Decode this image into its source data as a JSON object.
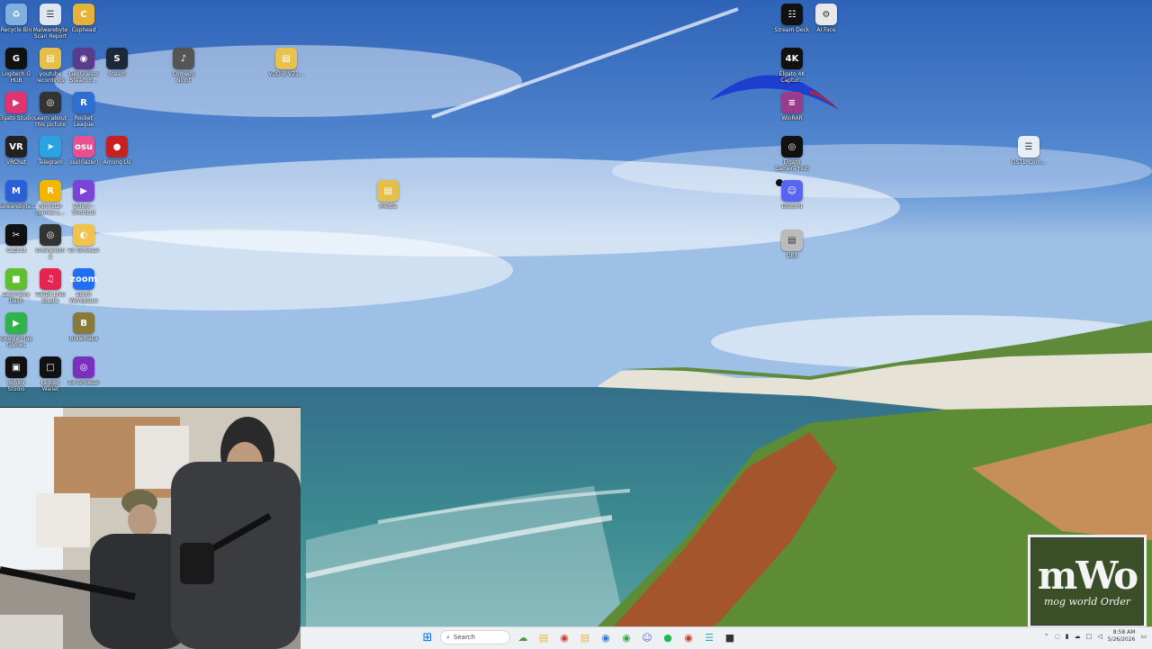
{
  "desktop_icons": [
    {
      "id": "recycle",
      "label": "Recycle Bin",
      "glyph": "♻",
      "color": "#7fb0e0",
      "icon": "recycle-bin-icon"
    },
    {
      "id": "malwarebytes-scan",
      "label": "Malwarebyte\nScan Report",
      "glyph": "☰",
      "color": "#dfe6ef",
      "icon": "document-icon"
    },
    {
      "id": "cuphead",
      "label": "Cuphead",
      "glyph": "C",
      "color": "#e6b33a",
      "icon": "cuphead-icon"
    },
    {
      "id": "logitech",
      "label": "Logitech G\nHUB",
      "glyph": "G",
      "color": "#111",
      "icon": "logitech-g-icon"
    },
    {
      "id": "youtube-rec",
      "label": "youtube\nrecordings",
      "glyph": "▤",
      "color": "#e4c04a",
      "icon": "folder-icon"
    },
    {
      "id": "geoguessr",
      "label": "GeoGuessr\nSteam E...",
      "glyph": "◉",
      "color": "#5a3b8c",
      "icon": "geoguessr-icon"
    },
    {
      "id": "steam",
      "label": "Steam",
      "glyph": "S",
      "color": "#1b2838",
      "icon": "steam-icon"
    },
    {
      "id": "comedy-night",
      "label": "Comedy\nNight",
      "glyph": "♪",
      "color": "#555",
      "icon": "microphone-icon"
    },
    {
      "id": "vdo-folder",
      "label": "VDO-B VZ1...",
      "glyph": "▤",
      "color": "#e8c24c",
      "icon": "folder-icon"
    },
    {
      "id": "elgato-studio",
      "label": "Elgato Studio",
      "glyph": "▶",
      "color": "#e0336f",
      "icon": "elgato-studio-icon"
    },
    {
      "id": "learn-pc",
      "label": "Learn about\nthis picture",
      "glyph": "◎",
      "color": "#333",
      "icon": "camera-icon"
    },
    {
      "id": "rocket-league",
      "label": "Rocket\nLeague",
      "glyph": "R",
      "color": "#2f6fd1",
      "icon": "rocket-league-icon"
    },
    {
      "id": "vrchat",
      "label": "VRChat",
      "glyph": "VR",
      "color": "#222",
      "icon": "vrchat-icon"
    },
    {
      "id": "telegram",
      "label": "Telegram",
      "glyph": "➤",
      "color": "#2aa3e0",
      "icon": "telegram-icon"
    },
    {
      "id": "osu",
      "label": "osu!(lazer)",
      "glyph": "osu",
      "color": "#e8508f",
      "icon": "osu-icon"
    },
    {
      "id": "among-us",
      "label": "Among Us",
      "glyph": "●",
      "color": "#c8201f",
      "icon": "among-us-icon"
    },
    {
      "id": "malwarebytes",
      "label": "Malwarebyte...",
      "glyph": "M",
      "color": "#2b5fd9",
      "icon": "malwarebytes-icon"
    },
    {
      "id": "rockstar",
      "label": "Rockstar\nGames L...",
      "glyph": "R",
      "color": "#f3b600",
      "icon": "rockstar-icon"
    },
    {
      "id": "videos-shortcut",
      "label": "Videos -\nShortcut",
      "glyph": "▶",
      "color": "#7a45d6",
      "icon": "videos-icon"
    },
    {
      "id": "imedia",
      "label": "iMedia",
      "glyph": "▤",
      "color": "#e3c04c",
      "icon": "folder-icon"
    },
    {
      "id": "capcut",
      "label": "CapCut",
      "glyph": "✂",
      "color": "#111",
      "icon": "capcut-icon"
    },
    {
      "id": "overwatch",
      "label": "Overwatch\n2",
      "glyph": "◎",
      "color": "#333",
      "icon": "overwatch-icon"
    },
    {
      "id": "tor-browser",
      "label": "Tor Browser",
      "glyph": "◐",
      "color": "#f2c24a",
      "icon": "tor-browser-icon"
    },
    {
      "id": "geometry-dash",
      "label": "Geometry\nDash",
      "glyph": "■",
      "color": "#5fbf2c",
      "icon": "geometry-dash-icon"
    },
    {
      "id": "tiktok-live",
      "label": "TikTok LIVE\nStudio",
      "glyph": "♫",
      "color": "#e5244f",
      "icon": "tiktok-icon"
    },
    {
      "id": "zoom",
      "label": "Zoom\nWorkplace",
      "glyph": "zoom",
      "color": "#1f6ef5",
      "icon": "zoom-icon"
    },
    {
      "id": "google-play",
      "label": "Google Play\nGames",
      "glyph": "▶",
      "color": "#2fb34a",
      "icon": "google-play-icon"
    },
    {
      "id": "brawlhalla",
      "label": "Brawlhalla",
      "glyph": "B",
      "color": "#8a7a3a",
      "icon": "brawlhalla-icon"
    },
    {
      "id": "roblox",
      "label": "Roblox\nStudio",
      "glyph": "▣",
      "color": "#111",
      "icon": "roblox-icon"
    },
    {
      "id": "ledger",
      "label": "Ledger\nWallet",
      "glyph": "□",
      "color": "#111",
      "icon": "ledger-icon"
    },
    {
      "id": "tor-browser-2",
      "label": "Tor Browser",
      "glyph": "◎",
      "color": "#7b2fbf",
      "icon": "tor-browser-icon"
    },
    {
      "id": "stream-deck",
      "label": "Stream Deck",
      "glyph": "☷",
      "color": "#111",
      "icon": "stream-deck-icon"
    },
    {
      "id": "ai-face",
      "label": "AI Face",
      "glyph": "⚙",
      "color": "#e8e8e8",
      "icon": "ai-face-icon"
    },
    {
      "id": "elgato-4k",
      "label": "Elgato 4K\nCaptur...",
      "glyph": "4K",
      "color": "#111",
      "icon": "elgato-4k-icon"
    },
    {
      "id": "winrar",
      "label": "WinRAR",
      "glyph": "≡",
      "color": "#9b3b8c",
      "icon": "winrar-icon"
    },
    {
      "id": "elgato-camera-hub",
      "label": "Elgato\nCamera Hub",
      "glyph": "◎",
      "color": "#111",
      "icon": "camera-hub-icon"
    },
    {
      "id": "discord",
      "label": "Discord",
      "glyph": "☺",
      "color": "#5865f2",
      "icon": "discord-icon"
    },
    {
      "id": "obs",
      "label": "OBS",
      "glyph": "▤",
      "color": "#bbb",
      "icon": "video-file-icon"
    },
    {
      "id": "dst1",
      "label": "DST1_Com...",
      "glyph": "☰",
      "color": "#e8eef5",
      "icon": "document-icon"
    }
  ],
  "watermark": {
    "mark": "mWo",
    "tagline": "mog world Order"
  },
  "taskbar": {
    "search_placeholder": "Search",
    "time": "8:58 AM",
    "date": "5/26/2026",
    "apps": [
      {
        "name": "widgets-icon",
        "glyph": "☁",
        "color": "#4a9a3a"
      },
      {
        "name": "file-explorer-icon",
        "glyph": "▤",
        "color": "#e5b73b"
      },
      {
        "name": "chrome-icon",
        "glyph": "◉",
        "color": "#d93a2a"
      },
      {
        "name": "folder-icon",
        "glyph": "▤",
        "color": "#e5b73b"
      },
      {
        "name": "chrome-profile-icon",
        "glyph": "◉",
        "color": "#2a7be4"
      },
      {
        "name": "chrome-alt-icon",
        "glyph": "◉",
        "color": "#39a84c"
      },
      {
        "name": "discord-icon",
        "glyph": "☺",
        "color": "#5865f2"
      },
      {
        "name": "spotify-icon",
        "glyph": "●",
        "color": "#1db954"
      },
      {
        "name": "chrome-beta-icon",
        "glyph": "◉",
        "color": "#c83a2a"
      },
      {
        "name": "notepad-icon",
        "glyph": "☰",
        "color": "#2a9ad9"
      },
      {
        "name": "minecraft-icon",
        "glyph": "■",
        "color": "#333"
      }
    ]
  }
}
